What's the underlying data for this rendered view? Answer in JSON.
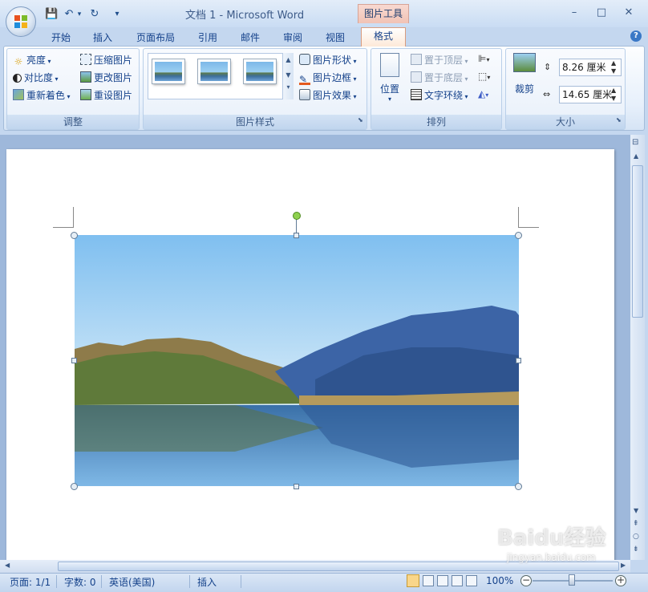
{
  "window": {
    "title": "文档 1 - Microsoft Word",
    "context_tab": "图片工具",
    "buttons": [
      "–",
      "□",
      "✕"
    ]
  },
  "qat": {
    "save": "💾",
    "undo": "↶",
    "redo": "↻",
    "more": "▾"
  },
  "tabs": [
    "开始",
    "插入",
    "页面布局",
    "引用",
    "邮件",
    "审阅",
    "视图"
  ],
  "active_tab": "格式",
  "ribbon": {
    "adjust": {
      "label": "调整",
      "brightness": "亮度",
      "contrast": "对比度",
      "recolor": "重新着色",
      "compress": "压缩图片",
      "change": "更改图片",
      "reset": "重设图片"
    },
    "styles": {
      "label": "图片样式",
      "shape": "图片形状",
      "border": "图片边框",
      "effects": "图片效果"
    },
    "arrange": {
      "label": "排列",
      "position": "位置",
      "bring_front": "置于顶层",
      "send_back": "置于底层",
      "wrap": "文字环绕"
    },
    "size": {
      "label": "大小",
      "crop": "裁剪",
      "height": "8.26 厘米",
      "width": "14.65 厘米"
    }
  },
  "status": {
    "page": "页面: 1/1",
    "words": "字数: 0",
    "lang": "英语(美国)",
    "mode": "插入",
    "zoom": "100%"
  },
  "watermark": {
    "logo": "Baidu经验",
    "url": "jingyan.baidu.com"
  },
  "colors": {
    "ribbon_bg": "#e7f0fb",
    "context_tab": "#f1c3b5",
    "text": "#15428b"
  }
}
